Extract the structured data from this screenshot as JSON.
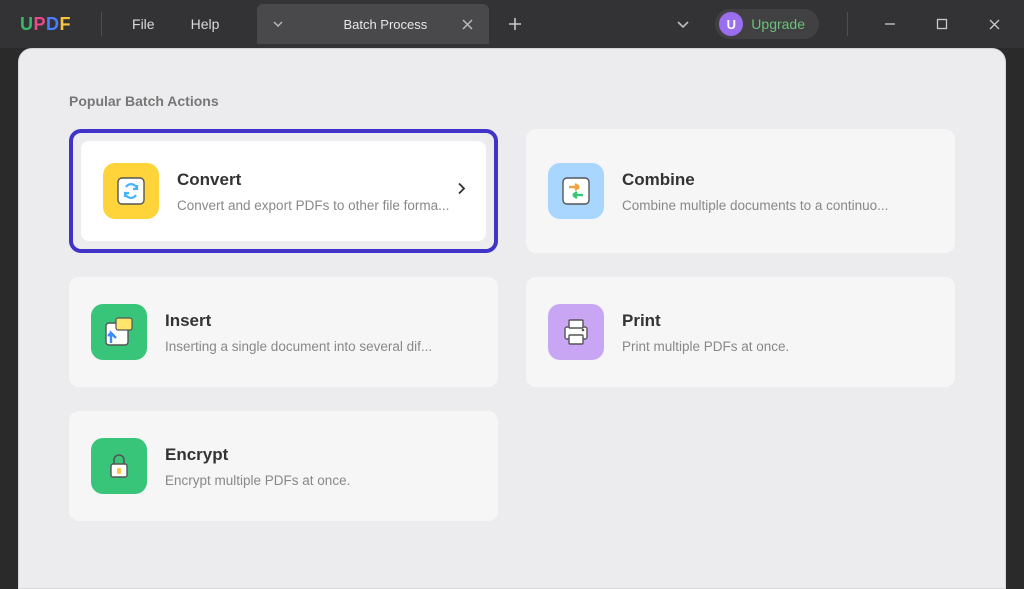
{
  "titlebar": {
    "logo_letters": [
      "U",
      "P",
      "D",
      "F"
    ],
    "menu": {
      "file": "File",
      "help": "Help"
    },
    "tab_title": "Batch Process",
    "upgrade_badge": "U",
    "upgrade_label": "Upgrade"
  },
  "section": {
    "heading": "Popular Batch Actions"
  },
  "cards": {
    "convert": {
      "title": "Convert",
      "desc": "Convert and export PDFs to other file forma..."
    },
    "combine": {
      "title": "Combine",
      "desc": "Combine multiple documents to a continuo..."
    },
    "insert": {
      "title": "Insert",
      "desc": "Inserting a single document into several dif..."
    },
    "print": {
      "title": "Print",
      "desc": "Print multiple PDFs at once."
    },
    "encrypt": {
      "title": "Encrypt",
      "desc": "Encrypt multiple PDFs at once."
    }
  }
}
